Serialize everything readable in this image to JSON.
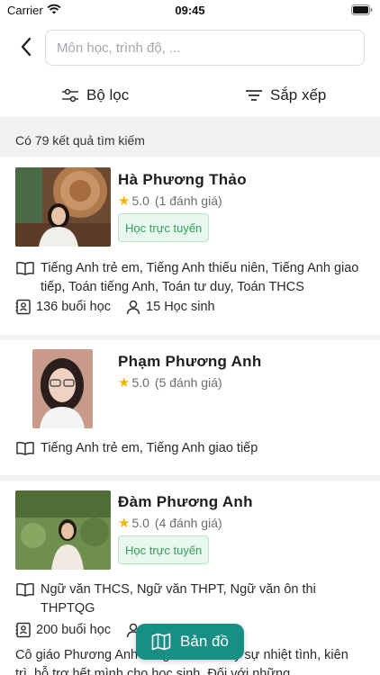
{
  "status_bar": {
    "carrier": "Carrier",
    "time": "09:45"
  },
  "search": {
    "value": "",
    "placeholder": "Môn học, trình độ, ..."
  },
  "toolbar": {
    "filter_label": "Bộ lọc",
    "sort_label": "Sắp xếp"
  },
  "results": {
    "summary": "Có 79 kết quả tìm kiếm"
  },
  "tutors": [
    {
      "name": "Hà Phương Thảo",
      "rating": "5.0",
      "reviews": "(1 đánh giá)",
      "badge": "Học trực tuyến",
      "subjects": "Tiếng Anh trẻ em, Tiếng Anh thiếu niên, Tiếng Anh giao tiếp, Toán tiếng Anh, Toán tư duy, Toán THCS",
      "sessions": "136 buổi học",
      "students": "15 Học sinh"
    },
    {
      "name": "Phạm Phương Anh",
      "rating": "5.0",
      "reviews": "(5 đánh giá)",
      "subjects": "Tiếng Anh trẻ em, Tiếng Anh giao tiếp"
    },
    {
      "name": "Đàm Phương Anh",
      "rating": "5.0",
      "reviews": "(4 đánh giá)",
      "badge": "Học trực tuyến",
      "subjects": "Ngữ văn THCS, Ngữ văn THPT, Ngữ văn ôn thi THPTQG",
      "sessions": "200 buổi học",
      "description": "Cô giáo Phương Anh là người tràn đầy sự nhiệt tình, kiên trì, hỗ trợ hết mình cho học sinh. Đối với những"
    }
  ],
  "map_button": {
    "label": "Bản đồ"
  },
  "colors": {
    "accent": "#178f84",
    "badge_text": "#2fa05a",
    "star": "#f5b301"
  }
}
